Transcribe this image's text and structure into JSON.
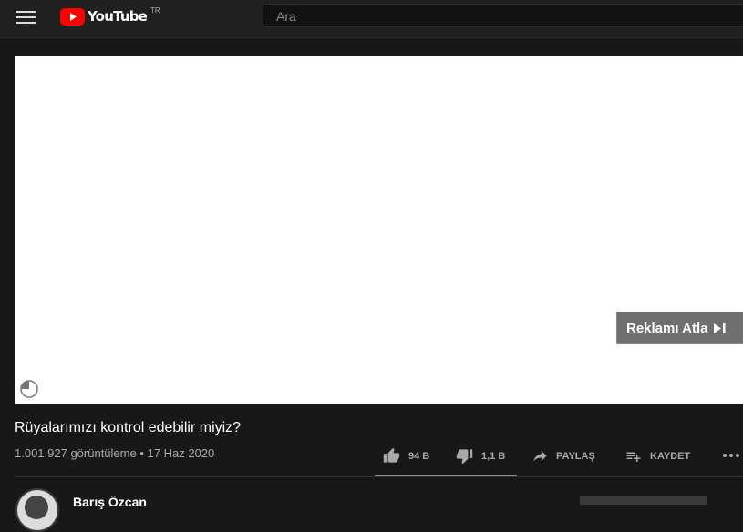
{
  "header": {
    "logo_text": "YouTube",
    "logo_region": "TR",
    "search_placeholder": "Ara"
  },
  "player": {
    "skip_ad_label": "Reklamı Atla"
  },
  "video": {
    "title": "Rüyalarımızı kontrol edebilir miyiz?",
    "views": "1.001.927 görüntüleme",
    "separator": "•",
    "date": "17 Haz 2020"
  },
  "actions": {
    "like_count": "94 B",
    "dislike_count": "1,1 B",
    "share_label": "PAYLAŞ",
    "save_label": "KAYDET"
  },
  "channel": {
    "name": "Barış Özcan"
  },
  "colors": {
    "background": "#181818",
    "masthead": "#202020",
    "brand_red": "#ff0000",
    "secondary_text": "#aaaaaa"
  }
}
